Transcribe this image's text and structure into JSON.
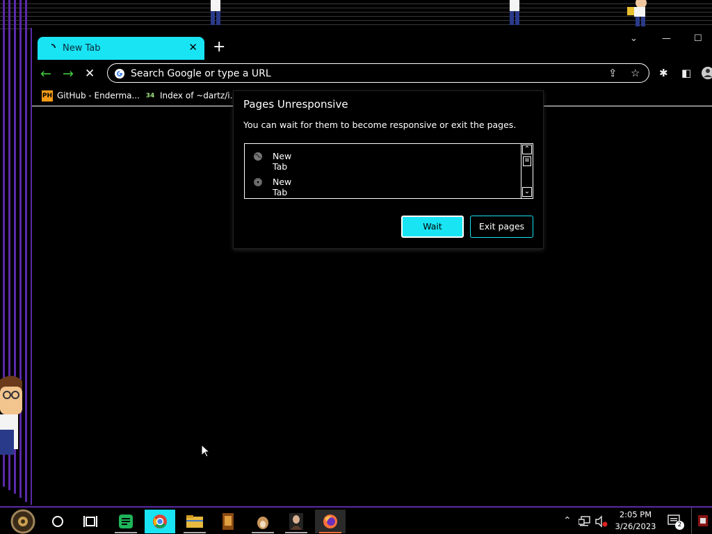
{
  "browser": {
    "tab": {
      "title": "New Tab",
      "close_icon": "close-icon"
    },
    "new_tab_icon": "plus-icon",
    "window_controls": {
      "chevron": "⌄",
      "minimize": "—",
      "maximize": "☐"
    },
    "omnibox": {
      "placeholder": "Search Google or type a URL"
    },
    "bookmarks": [
      {
        "icon_text": "PH",
        "label": "GitHub - Enderma..."
      },
      {
        "icon_text": "34",
        "label": "Index of ~dartz/i..."
      }
    ]
  },
  "dialog": {
    "title": "Pages Unresponsive",
    "message": "You can wait for them to become responsive or exit the pages.",
    "pages": [
      {
        "label": "New Tab"
      },
      {
        "label": "New Tab"
      }
    ],
    "wait_label": "Wait",
    "exit_label": "Exit pages"
  },
  "taskbar": {
    "time": "2:05 PM",
    "date": "3/26/2023",
    "notification_count": "2"
  },
  "colors": {
    "accent": "#19e4f4",
    "border_purple": "#5b2aa8",
    "background": "#000000"
  }
}
